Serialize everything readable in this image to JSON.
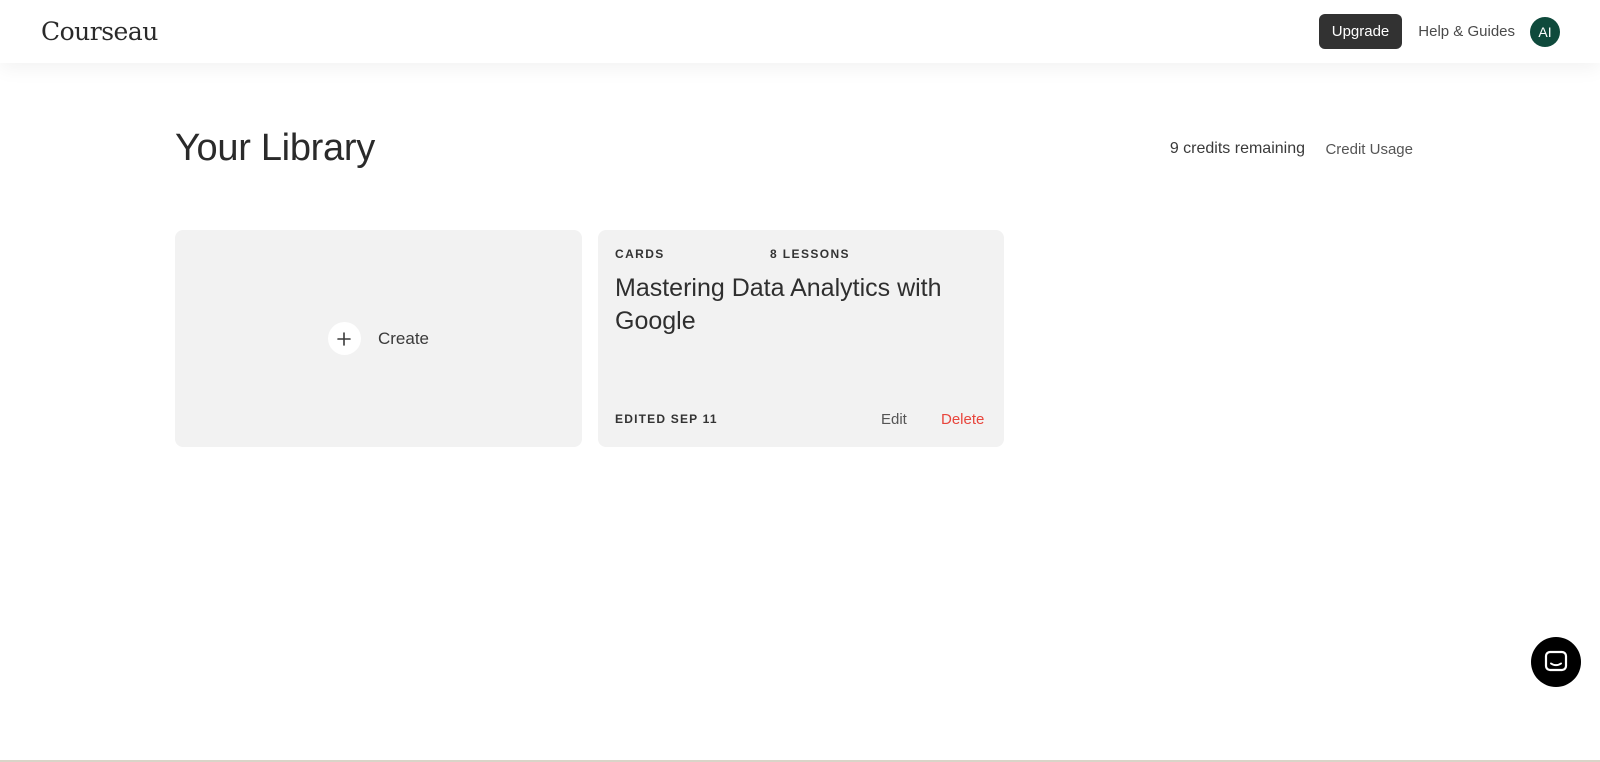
{
  "app": {
    "logo": "Courseau"
  },
  "topbar": {
    "upgrade_label": "Upgrade",
    "help_label": "Help & Guides",
    "avatar_initials": "AI",
    "avatar_color": "#0f4a3c"
  },
  "library": {
    "title": "Your Library",
    "credits_text": "9 credits remaining",
    "credit_usage_label": "Credit Usage"
  },
  "create_card": {
    "icon": "plus-icon",
    "label": "Create"
  },
  "courses": [
    {
      "type": "CARDS",
      "lessons": "8 LESSONS",
      "title": "Mastering Data Analytics with Google",
      "edited": "EDITED SEP 11",
      "edit_label": "Edit",
      "delete_label": "Delete"
    }
  ],
  "chat_widget": {
    "icon": "chat-icon"
  },
  "colors": {
    "accent_dark": "#323232",
    "delete_red": "#e8453c",
    "card_bg": "#f2f2f2"
  }
}
